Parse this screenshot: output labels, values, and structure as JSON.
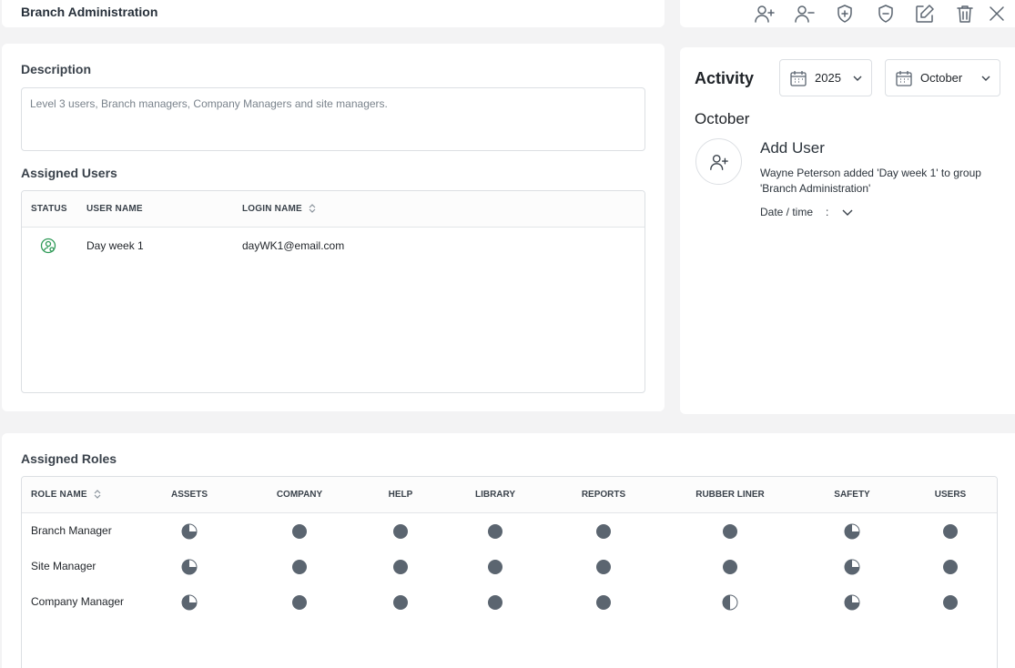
{
  "header": {
    "title": "Branch Administration"
  },
  "toolbar": {
    "icons": [
      "add-user-icon",
      "remove-user-icon",
      "add-role-icon",
      "remove-role-icon",
      "edit-icon",
      "delete-icon",
      "close-icon"
    ]
  },
  "description": {
    "label": "Description",
    "value": "Level 3 users, Branch managers, Company Managers and site managers."
  },
  "assigned_users": {
    "label": "Assigned Users",
    "columns": [
      "STATUS",
      "USER NAME",
      "LOGIN NAME"
    ],
    "rows": [
      {
        "status": "active",
        "user_name": "Day week 1",
        "login_name": "dayWK1@email.com"
      }
    ]
  },
  "activity": {
    "title": "Activity",
    "year": "2025",
    "month": "October",
    "month_heading": "October",
    "event": {
      "title": "Add User",
      "description": "Wayne Peterson added 'Day week 1' to group 'Branch Administration'",
      "date_label": "Date / time",
      "date_sep": ":"
    }
  },
  "assigned_roles": {
    "label": "Assigned Roles",
    "name_column": "ROLE NAME",
    "columns": [
      "ASSETS",
      "COMPANY",
      "HELP",
      "LIBRARY",
      "REPORTS",
      "RUBBER LINER",
      "SAFETY",
      "USERS"
    ],
    "rows": [
      {
        "name": "Branch Manager",
        "levels": [
          0.75,
          1,
          1,
          1,
          1,
          1,
          0.75,
          1
        ]
      },
      {
        "name": "Site Manager",
        "levels": [
          0.75,
          1,
          1,
          1,
          1,
          1,
          0.75,
          1
        ]
      },
      {
        "name": "Company Manager",
        "levels": [
          0.75,
          1,
          1,
          1,
          1,
          0.5,
          0.75,
          1
        ]
      }
    ]
  },
  "colors": {
    "icon": "#5b6570",
    "pie": "#5b6570",
    "status_active": "#2f9a57"
  }
}
